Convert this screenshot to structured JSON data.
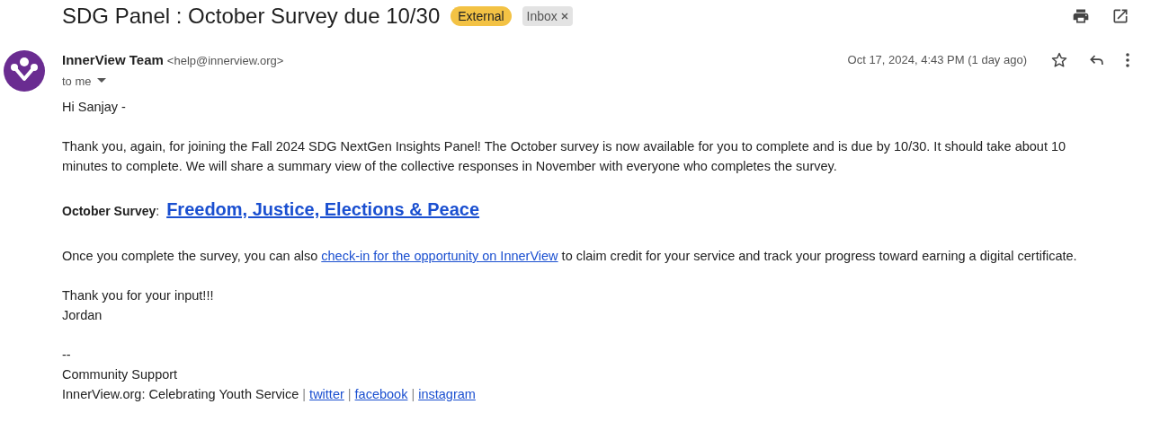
{
  "subject": "SDG Panel : October Survey due 10/30",
  "labels": [
    {
      "kind": "external",
      "text": "External"
    },
    {
      "kind": "inbox",
      "text": "Inbox",
      "removable": true
    }
  ],
  "sender": {
    "name": "InnerView Team",
    "email": "<help@innerview.org>"
  },
  "recipient": "to me",
  "date": "Oct 17, 2024, 4:43 PM (1 day ago)",
  "body": {
    "greeting": "Hi Sanjay -",
    "intro": "Thank you, again, for joining the Fall 2024 SDG NextGen Insights Panel! The October survey is now available for you to complete and is due by 10/30. It should take about 10 minutes to complete. We will share a summary view of the collective responses in November with everyone who completes the survey.",
    "survey": {
      "label": "October Survey",
      "separator": ":",
      "link": "Freedom, Justice, Elections & Peace"
    },
    "followup": {
      "before": "Once you complete the survey, you can also ",
      "link": "check-in for the opportunity on InnerView",
      "after": " to claim credit for your service and track your progress toward earning a digital certificate."
    },
    "closing": [
      "Thank you for your input!!!",
      "Jordan"
    ],
    "signature": [
      "--",
      "Community Support"
    ],
    "footer": {
      "text": "InnerView.org: Celebrating Youth Service",
      "separator": "|",
      "links": [
        "twitter",
        "facebook",
        "instagram"
      ]
    }
  }
}
